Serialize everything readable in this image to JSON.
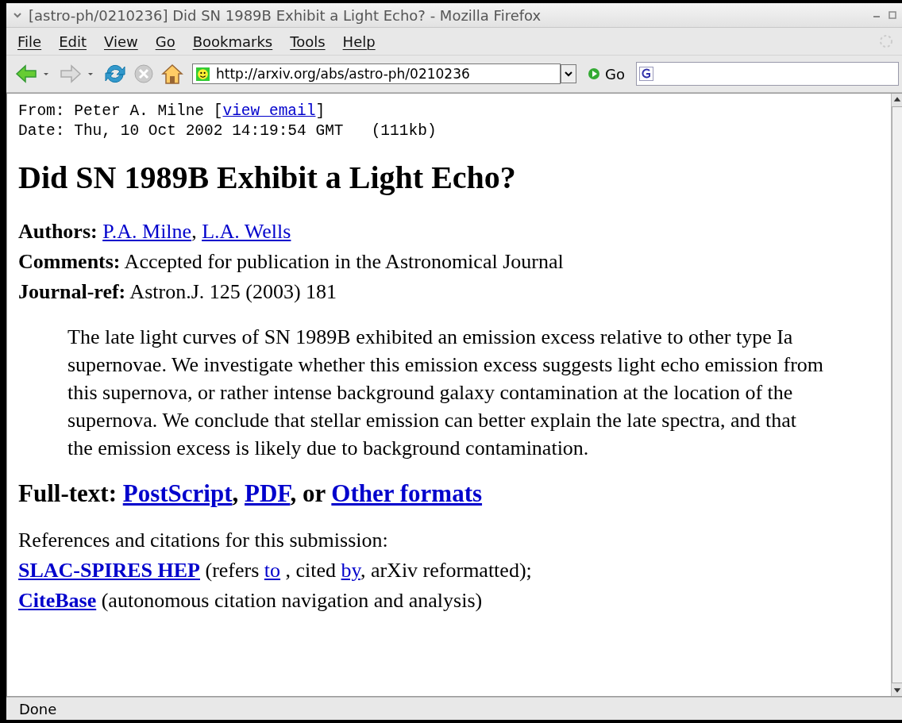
{
  "window": {
    "title": "[astro-ph/0210236] Did SN 1989B Exhibit a Light Echo? - Mozilla Firefox"
  },
  "menu": [
    {
      "label": "File"
    },
    {
      "label": "Edit"
    },
    {
      "label": "View"
    },
    {
      "label": "Go"
    },
    {
      "label": "Bookmarks"
    },
    {
      "label": "Tools"
    },
    {
      "label": "Help"
    }
  ],
  "toolbar": {
    "url": "http://arxiv.org/abs/astro-ph/0210236",
    "go": "Go"
  },
  "header_lines": [
    [
      {
        "text": "From: Peter A. Milne ["
      },
      {
        "text": "view email",
        "link": true
      },
      {
        "text": "]"
      }
    ],
    [
      {
        "text": "Date: Thu, 10 Oct 2002 14:19:54 GMT   (111kb)"
      }
    ]
  ],
  "title": "Did SN 1989B Exhibit a Light Echo?",
  "meta": [
    {
      "label": "Authors:",
      "parts": [
        {
          "text": "P.A. Milne",
          "link": true
        },
        {
          "text": ", "
        },
        {
          "text": "L.A. Wells",
          "link": true
        }
      ]
    },
    {
      "label": "Comments:",
      "parts": [
        {
          "text": "Accepted for publication in the Astronomical Journal"
        }
      ]
    },
    {
      "label": "Journal-ref:",
      "parts": [
        {
          "text": "Astron.J. 125 (2003) 181"
        }
      ]
    }
  ],
  "abstract": "The late light curves of SN 1989B exhibited an emission excess relative to other type Ia supernovae. We investigate whether this emission excess suggests light echo emission from this supernova, or rather intense background galaxy contamination at the location of the supernova. We conclude that stellar emission can better explain the late spectra, and that the emission excess is likely due to background contamination.",
  "fulltext": [
    {
      "text": "Full-text: "
    },
    {
      "text": "PostScript",
      "link": true
    },
    {
      "text": ", "
    },
    {
      "text": "PDF",
      "link": true
    },
    {
      "text": ", or "
    },
    {
      "text": "Other formats",
      "link": true
    }
  ],
  "refs_heading": "References and citations for this submission:",
  "refs": [
    [
      {
        "text": "SLAC-SPIRES HEP",
        "link": true,
        "bold": true
      },
      {
        "text": " (refers "
      },
      {
        "text": "to",
        "link": true
      },
      {
        "text": " , cited "
      },
      {
        "text": "by",
        "link": true
      },
      {
        "text": ", arXiv reformatted);"
      }
    ],
    [
      {
        "text": "CiteBase",
        "link": true,
        "bold": true
      },
      {
        "text": " (autonomous citation navigation and analysis)"
      }
    ]
  ],
  "status_bar": "Done"
}
